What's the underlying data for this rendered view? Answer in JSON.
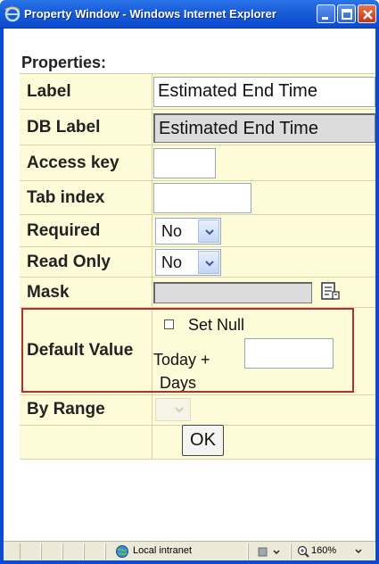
{
  "window": {
    "title": "Property Window - Windows Internet Explorer"
  },
  "properties": {
    "heading": "Properties:",
    "label_row": {
      "label": "Label",
      "value": "Estimated End Time"
    },
    "db_label_row": {
      "label": "DB Label",
      "value": "Estimated End Time"
    },
    "access_key_row": {
      "label": "Access key",
      "value": ""
    },
    "tab_index_row": {
      "label": "Tab index",
      "value": ""
    },
    "required_row": {
      "label": "Required",
      "value": "No"
    },
    "read_only_row": {
      "label": "Read Only",
      "value": "No"
    },
    "mask_row": {
      "label": "Mask",
      "value": ""
    },
    "default_value_row": {
      "label": "Default Value",
      "set_null_label": "Set Null",
      "set_null_checked": false,
      "today_plus_label": "Today +",
      "days_label": "Days",
      "days_value": ""
    },
    "by_range_row": {
      "label": "By Range"
    },
    "ok_label": "OK"
  },
  "statusbar": {
    "zone": "Local intranet",
    "zoom": "160%"
  },
  "colors": {
    "titlebar": "#0a4bd0",
    "table_bg": "#fdfbd8",
    "highlight_border": "#b03030"
  }
}
